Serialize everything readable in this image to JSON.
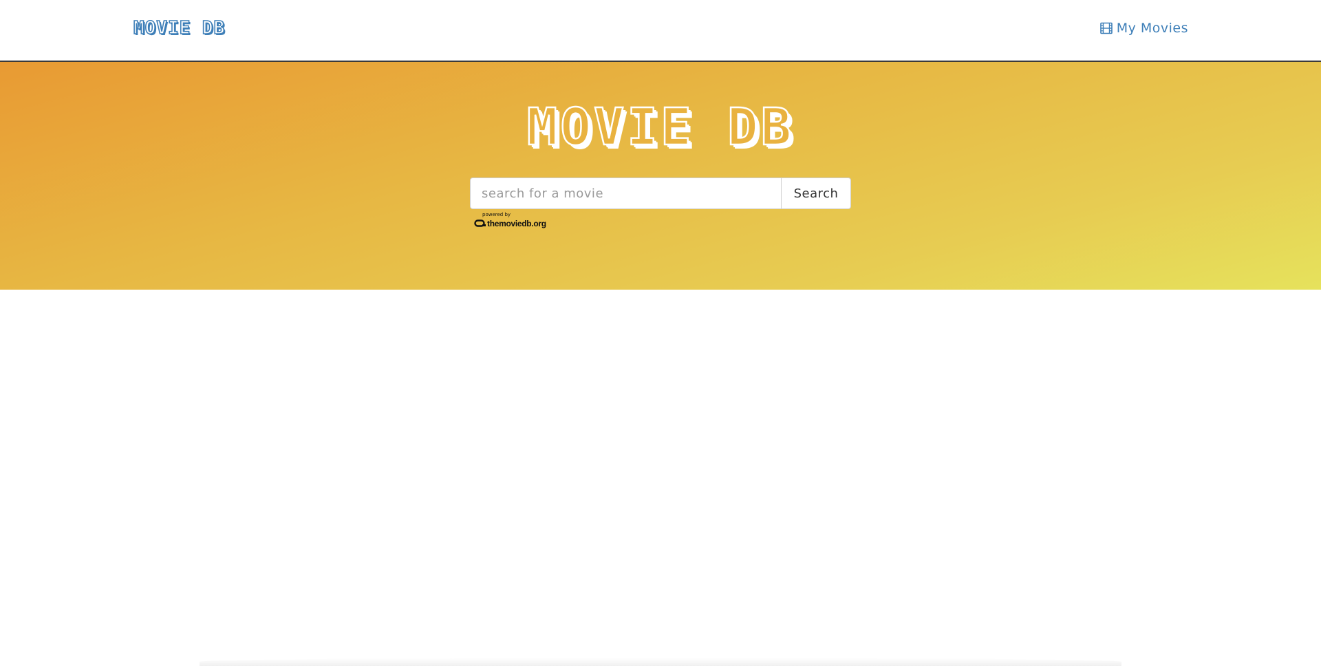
{
  "navbar": {
    "brand": "MOVIE DB",
    "my_movies_label": "My Movies",
    "my_movies_icon": "film-icon"
  },
  "hero": {
    "title": "MOVIE DB",
    "search": {
      "placeholder": "search for a movie",
      "value": "",
      "button_label": "Search"
    },
    "attribution": {
      "line1": "powered by",
      "line2": "themoviedb.org"
    }
  },
  "colors": {
    "link": "#3e7fb8",
    "hero_gradient_start": "#e89a33",
    "hero_gradient_end": "#e6e25c"
  }
}
